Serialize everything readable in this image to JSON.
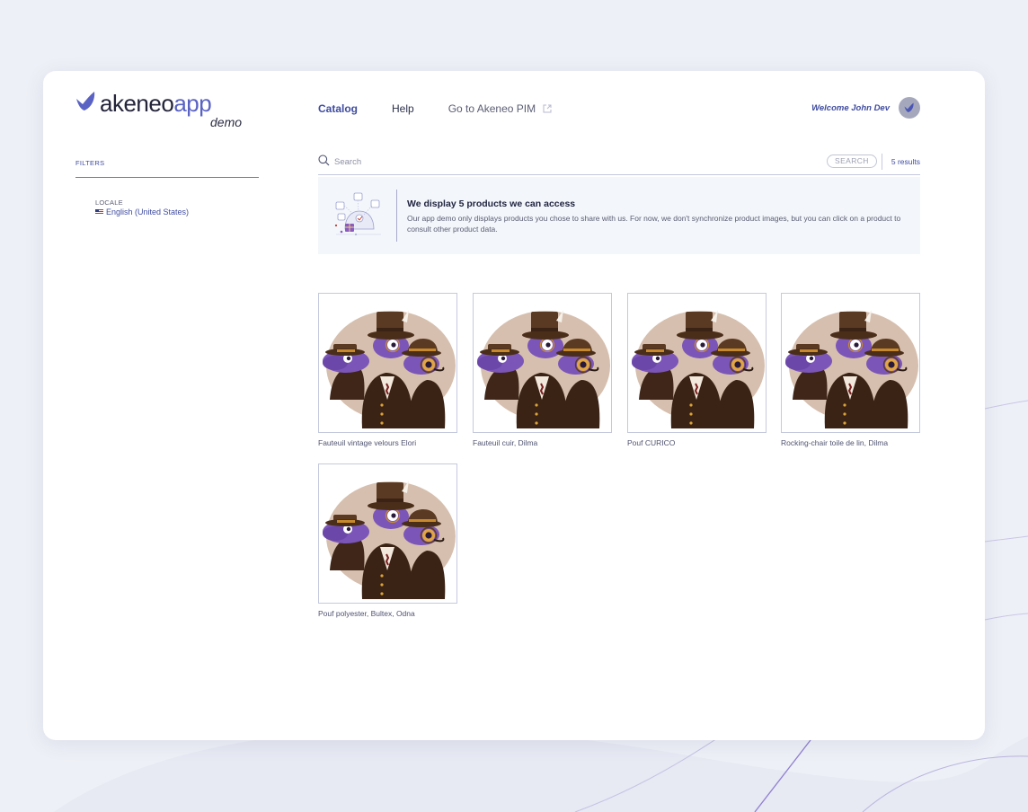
{
  "logo": {
    "brand_main": "akeneo",
    "brand_accent": "app",
    "tagline": "demo"
  },
  "nav": {
    "items": [
      {
        "label": "Catalog",
        "active": true
      },
      {
        "label": "Help",
        "active": false
      },
      {
        "label": "Go to Akeneo PIM",
        "active": false,
        "external": true
      }
    ]
  },
  "user": {
    "welcome": "Welcome John Dev"
  },
  "filters": {
    "title": "FILTERS",
    "locale": {
      "label": "LOCALE",
      "value": "English (United States)",
      "flag": "us-flag-icon"
    }
  },
  "search": {
    "placeholder": "Search",
    "button_label": "SEARCH",
    "results": "5 results"
  },
  "info": {
    "title": "We display 5 products we can access",
    "text": "Our app demo only displays products you chose to share with us. For now, we don't synchronize product images, but you can click on a product to consult other product data."
  },
  "products": [
    {
      "name": "Fauteuil vintage velours Elori"
    },
    {
      "name": "Fauteuil cuir, Dilma"
    },
    {
      "name": "Pouf CURICO"
    },
    {
      "name": "Rocking-chair toile de lin, Dilma"
    },
    {
      "name": "Pouf polyester, Bultex, Odna"
    }
  ],
  "colors": {
    "accent": "#3f4ca0",
    "brand_purple": "#5a63c4",
    "background": "#eef0f7",
    "info_bg": "#f3f6fa",
    "placeholder_blob": "#d6bfae",
    "mascot_purple": "#7b55b8"
  }
}
